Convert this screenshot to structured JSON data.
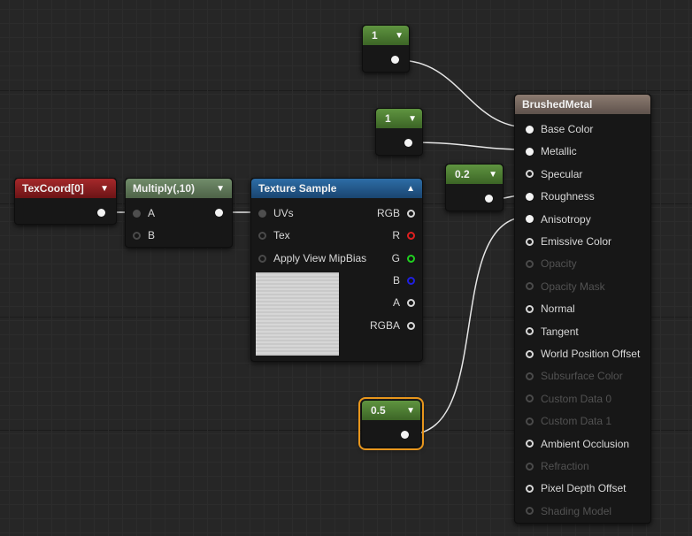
{
  "nodes": {
    "const1": {
      "value": "1"
    },
    "const2": {
      "value": "1"
    },
    "const3": {
      "value": "0.2"
    },
    "const4": {
      "value": "0.5"
    },
    "texcoord": {
      "title": "TexCoord[0]"
    },
    "multiply": {
      "title": "Multiply(,10)",
      "inputs": [
        "A",
        "B"
      ]
    },
    "texture": {
      "title": "Texture Sample",
      "inputs": [
        "UVs",
        "Tex",
        "Apply View MipBias"
      ],
      "outputs": [
        "RGB",
        "R",
        "G",
        "B",
        "A",
        "RGBA"
      ]
    },
    "material": {
      "title": "BrushedMetal",
      "pins": [
        {
          "label": "Base Color",
          "state": "connected"
        },
        {
          "label": "Metallic",
          "state": "connected"
        },
        {
          "label": "Specular",
          "state": "enabled"
        },
        {
          "label": "Roughness",
          "state": "connected"
        },
        {
          "label": "Anisotropy",
          "state": "connected"
        },
        {
          "label": "Emissive Color",
          "state": "enabled"
        },
        {
          "label": "Opacity",
          "state": "disabled"
        },
        {
          "label": "Opacity Mask",
          "state": "disabled"
        },
        {
          "label": "Normal",
          "state": "enabled"
        },
        {
          "label": "Tangent",
          "state": "enabled"
        },
        {
          "label": "World Position Offset",
          "state": "enabled"
        },
        {
          "label": "Subsurface Color",
          "state": "disabled"
        },
        {
          "label": "Custom Data 0",
          "state": "disabled"
        },
        {
          "label": "Custom Data 1",
          "state": "disabled"
        },
        {
          "label": "Ambient Occlusion",
          "state": "enabled"
        },
        {
          "label": "Refraction",
          "state": "disabled"
        },
        {
          "label": "Pixel Depth Offset",
          "state": "enabled"
        },
        {
          "label": "Shading Model",
          "state": "disabled"
        }
      ]
    }
  },
  "colors": {
    "constant_header": "#4f7f34",
    "texcoord_header": "#8e1f21",
    "multiply_header": "#617a5a",
    "texture_header": "#24598a",
    "material_header": "#7a6a60",
    "selection_outline": "#e8961c"
  }
}
